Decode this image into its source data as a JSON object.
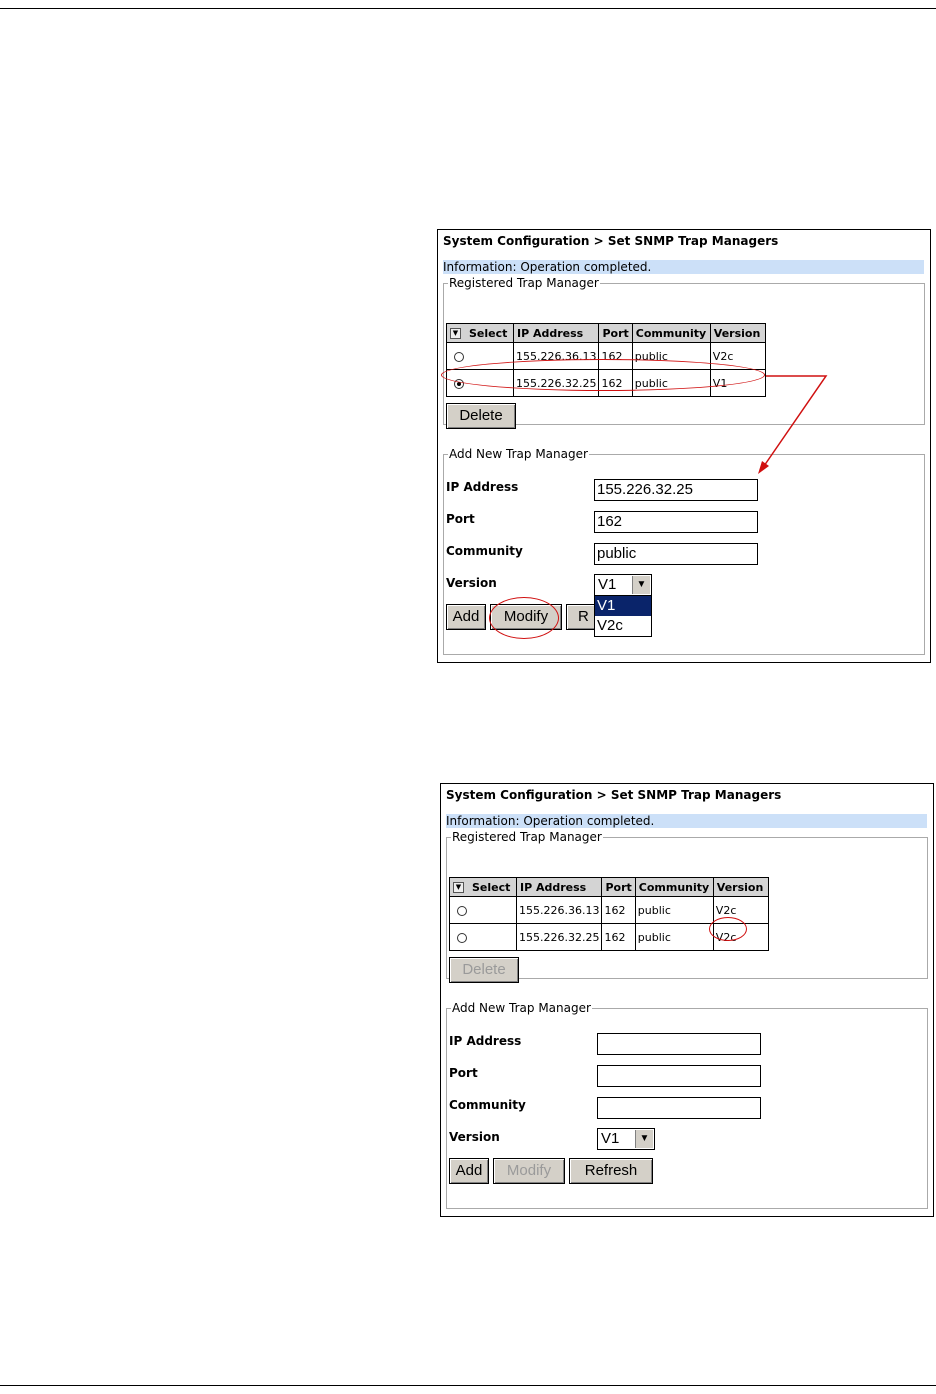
{
  "screens": [
    {
      "breadcrumb": "System Configuration > Set SNMP Trap Managers",
      "info": "Information: Operation completed.",
      "registered_legend": "Registered Trap Manager",
      "columns": [
        "Select",
        "IP Address",
        "Port",
        "Community",
        "Version"
      ],
      "rows": [
        {
          "selected": false,
          "ip": "155.226.36.13",
          "port": "162",
          "community": "public",
          "version": "V2c"
        },
        {
          "selected": true,
          "ip": "155.226.32.25",
          "port": "162",
          "community": "public",
          "version": "V1"
        }
      ],
      "delete_label": "Delete",
      "delete_enabled": true,
      "add_legend": "Add New Trap Manager",
      "form": {
        "ip_label": "IP Address",
        "ip_value": "155.226.32.25",
        "port_label": "Port",
        "port_value": "162",
        "community_label": "Community",
        "community_value": "public",
        "version_label": "Version",
        "version_value": "V1",
        "version_options": [
          "V1",
          "V2c"
        ],
        "highlighted_option": "V1"
      },
      "add_label": "Add",
      "modify_label": "Modify",
      "refresh_label_visible": "R"
    },
    {
      "breadcrumb": "System Configuration > Set SNMP Trap Managers",
      "info": "Information: Operation completed.",
      "registered_legend": "Registered Trap Manager",
      "columns": [
        "Select",
        "IP Address",
        "Port",
        "Community",
        "Version"
      ],
      "rows": [
        {
          "selected": false,
          "ip": "155.226.36.13",
          "port": "162",
          "community": "public",
          "version": "V2c"
        },
        {
          "selected": false,
          "ip": "155.226.32.25",
          "port": "162",
          "community": "public",
          "version": "V2c"
        }
      ],
      "delete_label": "Delete",
      "delete_enabled": false,
      "add_legend": "Add New Trap Manager",
      "form": {
        "ip_label": "IP Address",
        "ip_value": "",
        "port_label": "Port",
        "port_value": "",
        "community_label": "Community",
        "community_value": "",
        "version_label": "Version",
        "version_value": "V1"
      },
      "add_label": "Add",
      "modify_label": "Modify",
      "modify_enabled": false,
      "refresh_label": "Refresh"
    }
  ],
  "annotation_color": "#d01010"
}
